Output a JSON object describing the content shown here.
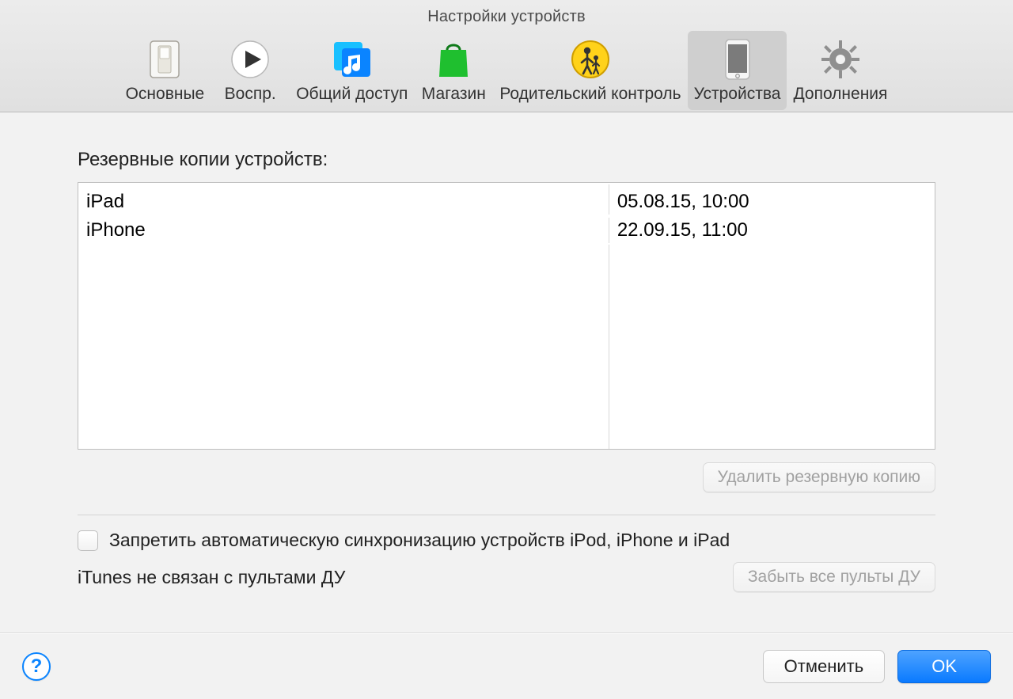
{
  "window_title": "Настройки устройств",
  "tabs": [
    {
      "label": "Основные"
    },
    {
      "label": "Воспр."
    },
    {
      "label": "Общий доступ"
    },
    {
      "label": "Магазин"
    },
    {
      "label": "Родительский контроль"
    },
    {
      "label": "Устройства"
    },
    {
      "label": "Дополнения"
    }
  ],
  "section_label": "Резервные копии устройств:",
  "backups": [
    {
      "name": "iPad",
      "date": "05.08.15, 10:00"
    },
    {
      "name": "iPhone",
      "date": "22.09.15, 11:00"
    }
  ],
  "delete_backup_button": "Удалить резервную копию",
  "prevent_sync_label": "Запретить автоматическую синхронизацию устройств iPod, iPhone и iPad",
  "remotes_status": "iTunes не связан с пультами ДУ",
  "forget_remotes_button": "Забыть все пульты ДУ",
  "help_glyph": "?",
  "cancel_label": "Отменить",
  "ok_label": "OK"
}
